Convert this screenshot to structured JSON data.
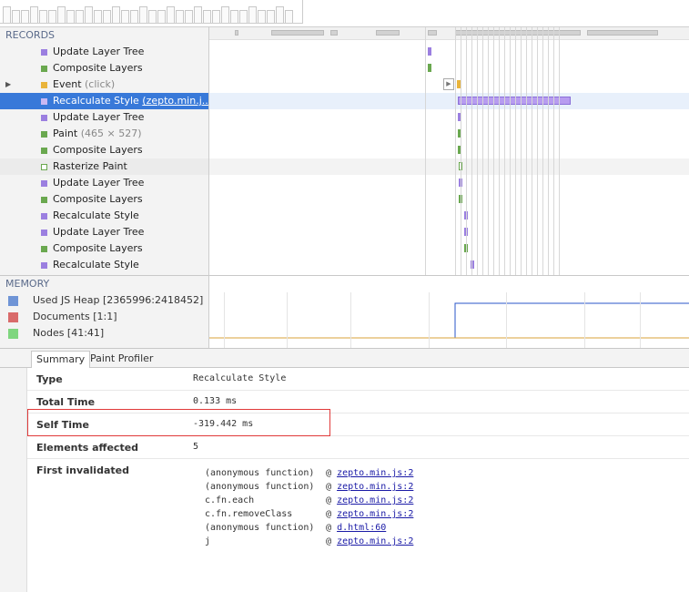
{
  "records": {
    "title": "RECORDS",
    "items": [
      {
        "label": "Update Layer Tree",
        "detail": "",
        "color": "#9b7fe0",
        "expandable": false
      },
      {
        "label": "Composite Layers",
        "detail": "",
        "color": "#6aa84f",
        "expandable": false
      },
      {
        "label": "Event",
        "detail": "(click)",
        "color": "#e9b43b",
        "expandable": true
      },
      {
        "label": "Recalculate Style",
        "detail": "(zepto.min.j...",
        "color": "#9b7fe0",
        "expandable": false,
        "selected": true
      },
      {
        "label": "Update Layer Tree",
        "detail": "",
        "color": "#9b7fe0",
        "expandable": false
      },
      {
        "label": "Paint",
        "detail": "(465 × 527)",
        "color": "#6aa84f",
        "expandable": false
      },
      {
        "label": "Composite Layers",
        "detail": "",
        "color": "#6aa84f",
        "expandable": false
      },
      {
        "label": "Rasterize Paint",
        "detail": "",
        "color": "#ffffff",
        "expandable": false,
        "outline": true
      },
      {
        "label": "Update Layer Tree",
        "detail": "",
        "color": "#9b7fe0",
        "expandable": false
      },
      {
        "label": "Composite Layers",
        "detail": "",
        "color": "#6aa84f",
        "expandable": false
      },
      {
        "label": "Recalculate Style",
        "detail": "",
        "color": "#9b7fe0",
        "expandable": false
      },
      {
        "label": "Update Layer Tree",
        "detail": "",
        "color": "#9b7fe0",
        "expandable": false
      },
      {
        "label": "Composite Layers",
        "detail": "",
        "color": "#6aa84f",
        "expandable": false
      },
      {
        "label": "Recalculate Style",
        "detail": "",
        "color": "#9b7fe0",
        "expandable": false
      }
    ]
  },
  "memory": {
    "title": "MEMORY",
    "items": [
      {
        "label": "Used JS Heap [2365996:2418452]",
        "color": "#6f94d6"
      },
      {
        "label": "Documents [1:1]",
        "color": "#d96b6b"
      },
      {
        "label": "Nodes [41:41]",
        "color": "#7fd67f"
      }
    ]
  },
  "tabs": [
    {
      "label": "Summary",
      "active": true
    },
    {
      "label": "Paint Profiler",
      "active": false
    }
  ],
  "summary": {
    "type_label": "Type",
    "type_value": "Recalculate Style",
    "total_label": "Total Time",
    "total_value": "0.133 ms",
    "self_label": "Self Time",
    "self_value": "-319.442 ms",
    "elements_label": "Elements affected",
    "elements_value": "5",
    "invalidated_label": "First invalidated",
    "stack": [
      {
        "fn": "(anonymous function)",
        "at": "@",
        "link": "zepto.min.js:2"
      },
      {
        "fn": "(anonymous function)",
        "at": "@",
        "link": "zepto.min.js:2"
      },
      {
        "fn": "c.fn.each",
        "at": "@",
        "link": "zepto.min.js:2"
      },
      {
        "fn": "c.fn.removeClass",
        "at": "@",
        "link": "zepto.min.js:2"
      },
      {
        "fn": "(anonymous function)",
        "at": "@",
        "link": "d.html:60"
      },
      {
        "fn": "j",
        "at": "@",
        "link": "zepto.min.js:2"
      }
    ]
  },
  "colors": {
    "selection": "#3879d9",
    "highlight_box": "#e03a3a",
    "heap_line": "#2855c8",
    "nodes_line": "#d8a13a"
  }
}
